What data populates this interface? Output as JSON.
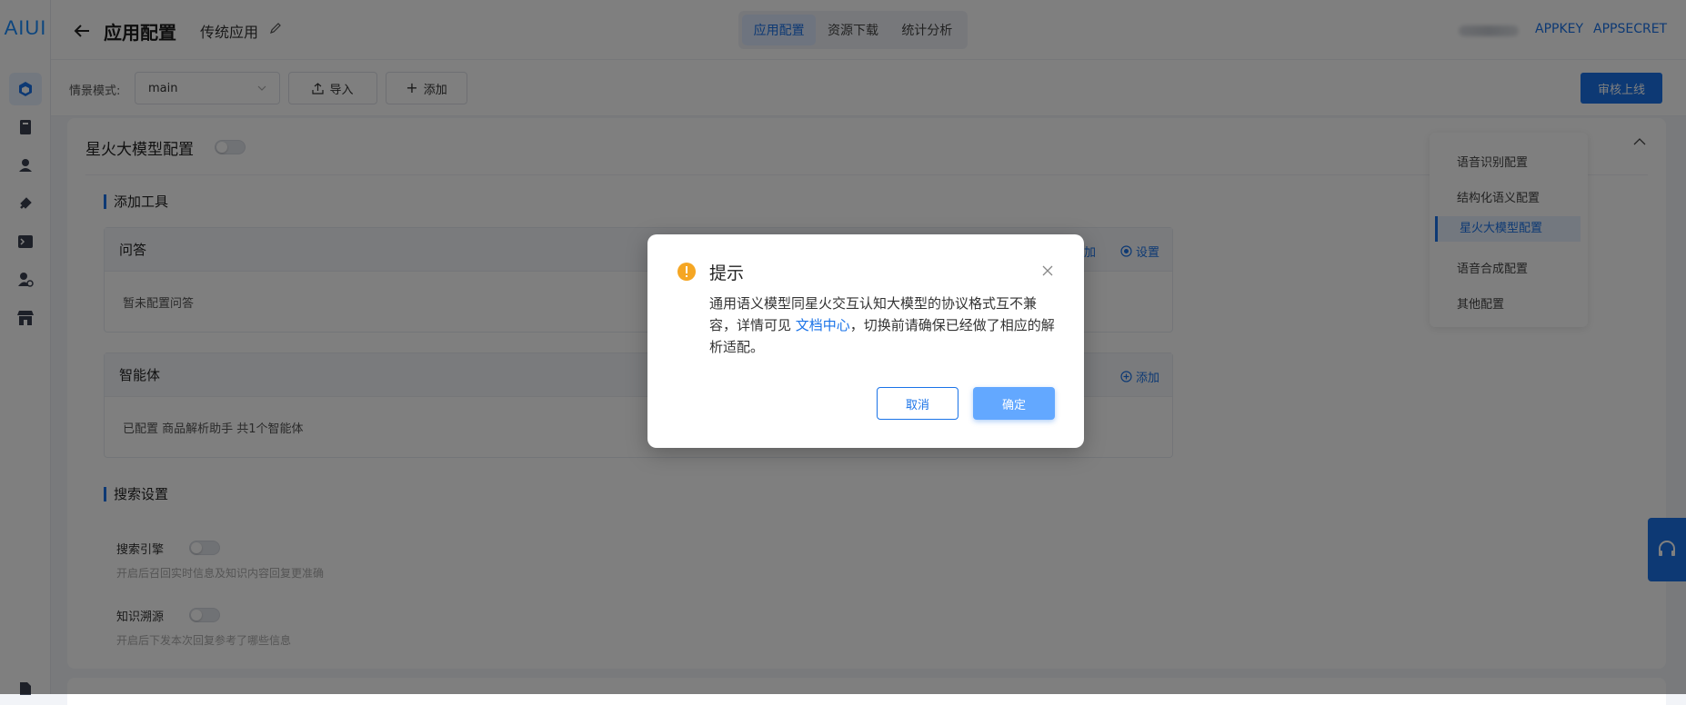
{
  "app": {
    "logo": "AIUI"
  },
  "colors": {
    "accent": "#1a73e8",
    "warning": "#f5a623"
  },
  "header": {
    "title": "应用配置",
    "subtitle": "传统应用",
    "tabs": [
      {
        "label": "应用配置",
        "active": true
      },
      {
        "label": "资源下载",
        "active": false
      },
      {
        "label": "统计分析",
        "active": false
      }
    ],
    "links": {
      "appkey": "APPKEY",
      "appsecret": "APPSECRET"
    }
  },
  "toolbar": {
    "scene_label": "情景模式:",
    "scene_value": "main",
    "import_label": "导入",
    "add_label": "添加",
    "submit_label": "审核上线"
  },
  "card": {
    "title": "星火大模型配置",
    "enabled": false,
    "add_tools": {
      "title": "添加工具",
      "qa": {
        "title": "问答",
        "action_add": "添加",
        "action_settings": "设置",
        "body": "暂未配置问答"
      },
      "agent": {
        "title": "智能体",
        "action_add": "添加",
        "body": "已配置 商品解析助手 共1个智能体"
      }
    },
    "search": {
      "title": "搜索设置",
      "engine": {
        "label": "搜索引擎",
        "hint": "开启后召回实时信息及知识内容回复更准确",
        "enabled": false
      },
      "trace": {
        "label": "知识溯源",
        "hint": "开启后下发本次回复参考了哪些信息",
        "enabled": false
      }
    }
  },
  "anchor_nav": {
    "items": [
      {
        "label": "语音识别配置",
        "active": false
      },
      {
        "label": "结构化语义配置",
        "active": false
      },
      {
        "label": "星火大模型配置",
        "active": true
      },
      {
        "label": "语音合成配置",
        "active": false
      },
      {
        "label": "其他配置",
        "active": false
      }
    ]
  },
  "dialog": {
    "title": "提示",
    "body_before": "通用语义模型同星火交互认知大模型的协议格式互不兼容，详情可见 ",
    "link": "文档中心",
    "body_after": "，切换前请确保已经做了相应的解析适配。",
    "cancel": "取消",
    "confirm": "确定"
  }
}
